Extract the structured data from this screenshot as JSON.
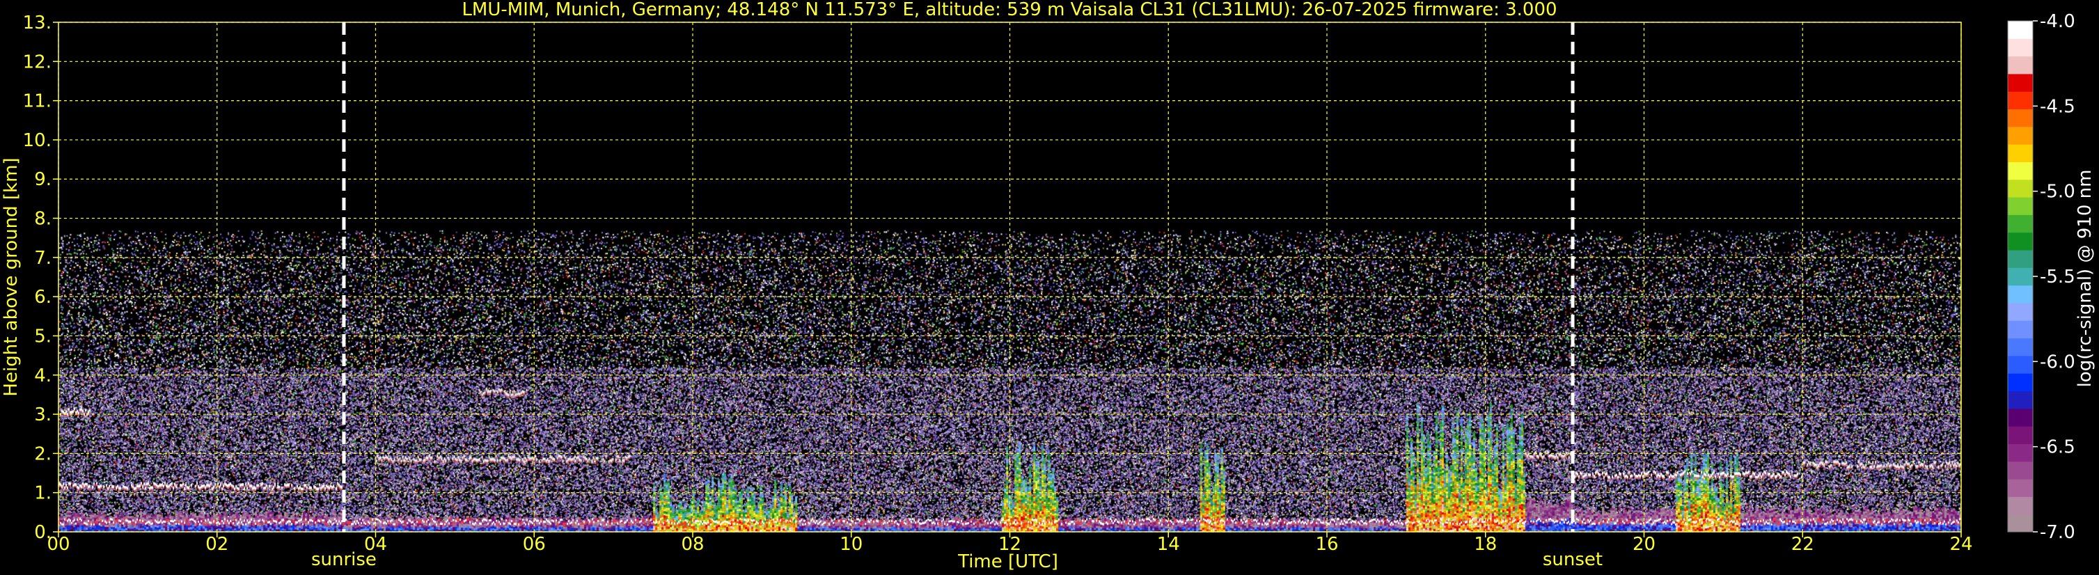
{
  "chart_data": {
    "type": "heatmap",
    "title": "LMU-MIM, Munich, Germany; 48.148° N 11.573° E, altitude: 539 m    Vaisala CL31 (CL31LMU): 26-07-2025    firmware: 3.000",
    "xlabel": "Time [UTC]",
    "ylabel": "Height above ground [km]",
    "xlim": [
      0,
      24
    ],
    "ylim": [
      0,
      13
    ],
    "x_ticks": [
      "00",
      "02",
      "04",
      "06",
      "08",
      "10",
      "12",
      "14",
      "16",
      "18",
      "20",
      "22",
      "24"
    ],
    "y_ticks": [
      "0.",
      "1.",
      "2.",
      "3.",
      "4.",
      "5.",
      "6.",
      "7.",
      "8.",
      "9.",
      "10.",
      "11.",
      "12.",
      "13."
    ],
    "grid": true,
    "markers": [
      {
        "label": "sunrise",
        "time": 3.6
      },
      {
        "label": "sunset",
        "time": 19.1
      }
    ],
    "colorbar": {
      "label": "log(rc-signal) @ 910 nm",
      "range": [
        -7.0,
        -4.0
      ],
      "ticks": [
        "-4.0",
        "-4.5",
        "-5.0",
        "-5.5",
        "-6.0",
        "-6.5",
        "-7.0"
      ],
      "colors": [
        "#a9909a",
        "#b289a3",
        "#a8649a",
        "#9a4a91",
        "#8a2a86",
        "#7a1479",
        "#5a0070",
        "#2020c0",
        "#0030ff",
        "#2a5cff",
        "#4a78ff",
        "#7090ff",
        "#90a8ff",
        "#70c0ff",
        "#40b0b0",
        "#30a080",
        "#109020",
        "#40b030",
        "#80d030",
        "#c0e020",
        "#f0ff40",
        "#ffd000",
        "#ffa000",
        "#ff7000",
        "#ff3000",
        "#e00000",
        "#f0c0c0",
        "#ffe0e0",
        "#ffffff"
      ]
    },
    "noise_top_km": 7.7,
    "boundary_layer": [
      {
        "t0": 0.0,
        "t1": 3.6,
        "h": 0.45
      },
      {
        "t0": 3.6,
        "t1": 7.5,
        "h": 0.35
      },
      {
        "t0": 7.5,
        "t1": 17.0,
        "h": 0.3
      },
      {
        "t0": 17.0,
        "t1": 19.1,
        "h": 0.8
      },
      {
        "t0": 19.1,
        "t1": 24.0,
        "h": 0.55
      }
    ],
    "cloud_layers": [
      {
        "t0": 0.0,
        "t1": 0.4,
        "h": 3.1
      },
      {
        "t0": 0.0,
        "t1": 3.6,
        "h": 1.2
      },
      {
        "t0": 5.3,
        "t1": 5.9,
        "h": 3.6
      },
      {
        "t0": 4.0,
        "t1": 7.2,
        "h": 1.9
      },
      {
        "t0": 18.5,
        "t1": 19.1,
        "h": 2.0
      },
      {
        "t0": 19.1,
        "t1": 22.0,
        "h": 1.5
      },
      {
        "t0": 22.0,
        "t1": 24.0,
        "h": 1.75
      }
    ],
    "convective_plumes": [
      {
        "t0": 7.5,
        "t1": 9.3,
        "top": 1.5
      },
      {
        "t0": 11.9,
        "t1": 12.6,
        "top": 2.4
      },
      {
        "t0": 14.4,
        "t1": 14.7,
        "top": 2.5
      },
      {
        "t0": 17.0,
        "t1": 18.5,
        "top": 3.3
      },
      {
        "t0": 20.4,
        "t1": 21.2,
        "top": 2.2
      }
    ]
  }
}
